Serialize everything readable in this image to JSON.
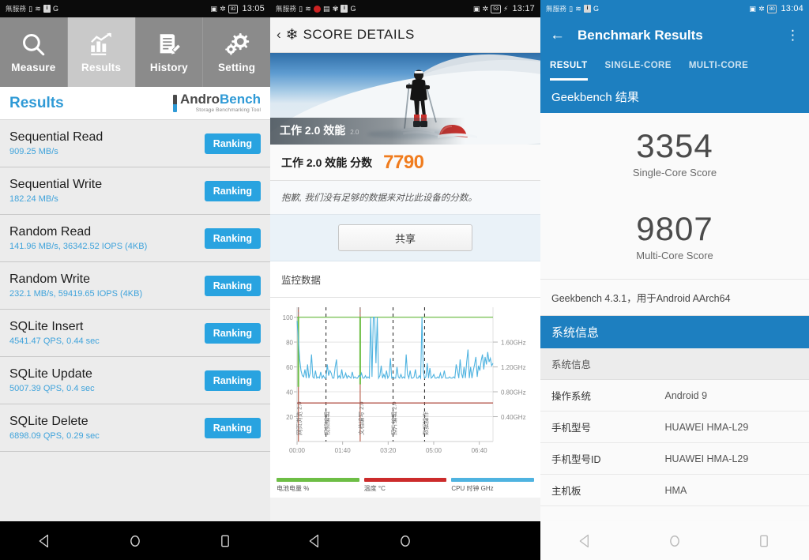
{
  "androbench": {
    "statusbar": {
      "carrier": "無服務",
      "indicator_g": "G",
      "battery": "82",
      "time": "13:05"
    },
    "tabs": [
      {
        "label": "Measure",
        "icon": "magnifier-icon",
        "active": false
      },
      {
        "label": "Results",
        "icon": "bar-chart-icon",
        "active": true
      },
      {
        "label": "History",
        "icon": "document-edit-icon",
        "active": false
      },
      {
        "label": "Setting",
        "icon": "gears-icon",
        "active": false
      }
    ],
    "header_title": "Results",
    "logo": {
      "part1": "Andro",
      "part2": "Bench",
      "tagline": "Storage Benchmarking Tool"
    },
    "rank_button_label": "Ranking",
    "rows": [
      {
        "title": "Sequential Read",
        "value": "909.25 MB/s"
      },
      {
        "title": "Sequential Write",
        "value": "182.24 MB/s"
      },
      {
        "title": "Random Read",
        "value": "141.96 MB/s, 36342.52 IOPS (4KB)"
      },
      {
        "title": "Random Write",
        "value": "232.1 MB/s, 59419.65 IOPS (4KB)"
      },
      {
        "title": "SQLite Insert",
        "value": "4541.47 QPS, 0.44 sec"
      },
      {
        "title": "SQLite Update",
        "value": "5007.39 QPS, 0.4 sec"
      },
      {
        "title": "SQLite Delete",
        "value": "6898.09 QPS, 0.29 sec"
      }
    ]
  },
  "threedmark": {
    "statusbar": {
      "carrier": "無服務",
      "indicator_g": "G",
      "battery": "53",
      "time": "13:17"
    },
    "appbar_title": "SCORE DETAILS",
    "hero_caption": "工作 2.0 效能",
    "hero_caption_sup": "2.0",
    "score_label": "工作 2.0 效能 分数",
    "score_value": "7790",
    "note": "抱歉, 我们没有足够的数据来对比此设备的分数。",
    "share_button": "共享",
    "section_title": "监控数据",
    "chart_data": {
      "type": "line",
      "title": "监控数据",
      "xlabel": "",
      "ylabel": "",
      "x_ticks": [
        "00:00",
        "01:40",
        "03:20",
        "05:00",
        "06:40"
      ],
      "y_left_ticks": [
        20,
        40,
        60,
        80,
        100
      ],
      "y_right_ticks": [
        "0.40GHz",
        "0.80GHz",
        "1.20GHz",
        "1.60GHz"
      ],
      "ylim": [
        0,
        108
      ],
      "y_right_lim": [
        0,
        2.16
      ],
      "grid": true,
      "legend_position": "bottom",
      "series": [
        {
          "name": "电池电量 %",
          "color": "#6dbe45",
          "constant_value": 100,
          "values": [
            100,
            100,
            100,
            100,
            100,
            100,
            100,
            100,
            100,
            100,
            100,
            100,
            100,
            100,
            100,
            100,
            100,
            100,
            100,
            100,
            100,
            100,
            100,
            100,
            100,
            100,
            100,
            100,
            100,
            100,
            100,
            100,
            100,
            100,
            100,
            100,
            100,
            100,
            100,
            100
          ]
        },
        {
          "name": "温度 °C",
          "color": "#cc2b2b",
          "constant_value": 31,
          "values": [
            31,
            31,
            31,
            31,
            31,
            31,
            31,
            31,
            31,
            31,
            31,
            31,
            31,
            31,
            31,
            31,
            31,
            31,
            31,
            31,
            31,
            31,
            31,
            31,
            31,
            31,
            31,
            31,
            31,
            31,
            31,
            31,
            31,
            31,
            31,
            31,
            31,
            31,
            31,
            31
          ]
        },
        {
          "name": "CPU 时钟 GHz",
          "color": "#4fb3e0",
          "values": [
            97,
            82,
            66,
            57,
            53,
            52,
            58,
            51,
            62,
            51,
            55,
            70,
            52,
            51,
            57,
            51,
            52,
            51,
            56,
            51,
            53,
            51,
            51,
            62,
            53,
            57,
            55,
            51,
            51,
            60,
            66,
            51,
            53,
            51,
            58,
            51,
            52,
            55,
            51,
            53,
            52,
            51,
            56,
            51,
            52,
            51,
            51,
            53,
            52,
            55,
            51,
            51,
            53,
            51,
            52,
            51,
            100,
            52,
            100,
            100,
            63,
            100,
            51,
            53,
            61,
            51,
            54,
            51,
            57,
            51,
            53,
            67,
            51,
            52,
            51,
            51,
            60,
            52,
            51,
            54,
            51,
            52,
            51,
            70,
            54,
            51,
            57,
            51,
            51,
            52,
            58,
            51,
            51,
            53,
            51,
            100,
            56,
            51,
            52,
            63,
            51,
            59,
            51,
            52,
            54,
            51,
            51,
            52,
            51,
            55,
            51,
            52,
            57,
            51,
            51,
            51,
            52,
            51,
            51,
            52,
            51,
            62,
            57,
            51,
            66,
            55,
            51,
            60,
            51,
            64,
            74,
            51,
            60,
            51,
            57,
            62,
            68,
            52,
            61,
            57,
            65,
            70,
            58,
            68,
            62,
            72,
            64,
            67,
            61,
            63
          ]
        }
      ],
      "annotations": [
        {
          "label": "网页浏览 2.0",
          "x_index": 1,
          "type": "solid-red"
        },
        {
          "label": "视频编辑",
          "x_index": 22,
          "type": "dashed"
        },
        {
          "label": "文档编写 2.0",
          "x_index": 48,
          "type": "solid-red"
        },
        {
          "label": "照片编辑 2.0",
          "x_index": 73,
          "type": "dashed"
        },
        {
          "label": "数据操作",
          "x_index": 97,
          "type": "dashed"
        }
      ]
    },
    "legend": [
      {
        "label": "电池电量 %",
        "color": "#6dbe45"
      },
      {
        "label": "温度 °C",
        "color": "#cc2b2b"
      },
      {
        "label": "CPU 时钟 GHz",
        "color": "#4fb3e0"
      }
    ]
  },
  "geekbench": {
    "statusbar": {
      "carrier": "無服務",
      "indicator_g": "G",
      "battery": "80",
      "time": "13:04"
    },
    "appbar_title": "Benchmark Results",
    "tabs": [
      {
        "label": "RESULT",
        "active": true
      },
      {
        "label": "SINGLE-CORE",
        "active": false
      },
      {
        "label": "MULTI-CORE",
        "active": false
      }
    ],
    "band_results": "Geekbench 结果",
    "scores": [
      {
        "value": "3354",
        "label": "Single-Core Score"
      },
      {
        "value": "9807",
        "label": "Multi-Core Score"
      }
    ],
    "version_line": "Geekbench 4.3.1，用于Android AArch64",
    "band_system": "系统信息",
    "system_subhead": "系统信息",
    "system_rows": [
      {
        "key": "操作系统",
        "value": "Android 9"
      },
      {
        "key": "手机型号",
        "value": "HUAWEI HMA-L29"
      },
      {
        "key": "手机型号ID",
        "value": "HUAWEI HMA-L29"
      },
      {
        "key": "主机板",
        "value": "HMA"
      }
    ]
  },
  "navbar": {
    "back": "back-triangle-icon",
    "home": "home-circle-icon",
    "recent": "recents-square-icon"
  },
  "colors": {
    "androbench_accent": "#29a3e0",
    "threedmark_score": "#f07c1e",
    "geekbench_blue": "#1d7fc0",
    "battery_green": "#6dbe45",
    "temp_red": "#cc2b2b",
    "cpu_blue": "#4fb3e0"
  }
}
